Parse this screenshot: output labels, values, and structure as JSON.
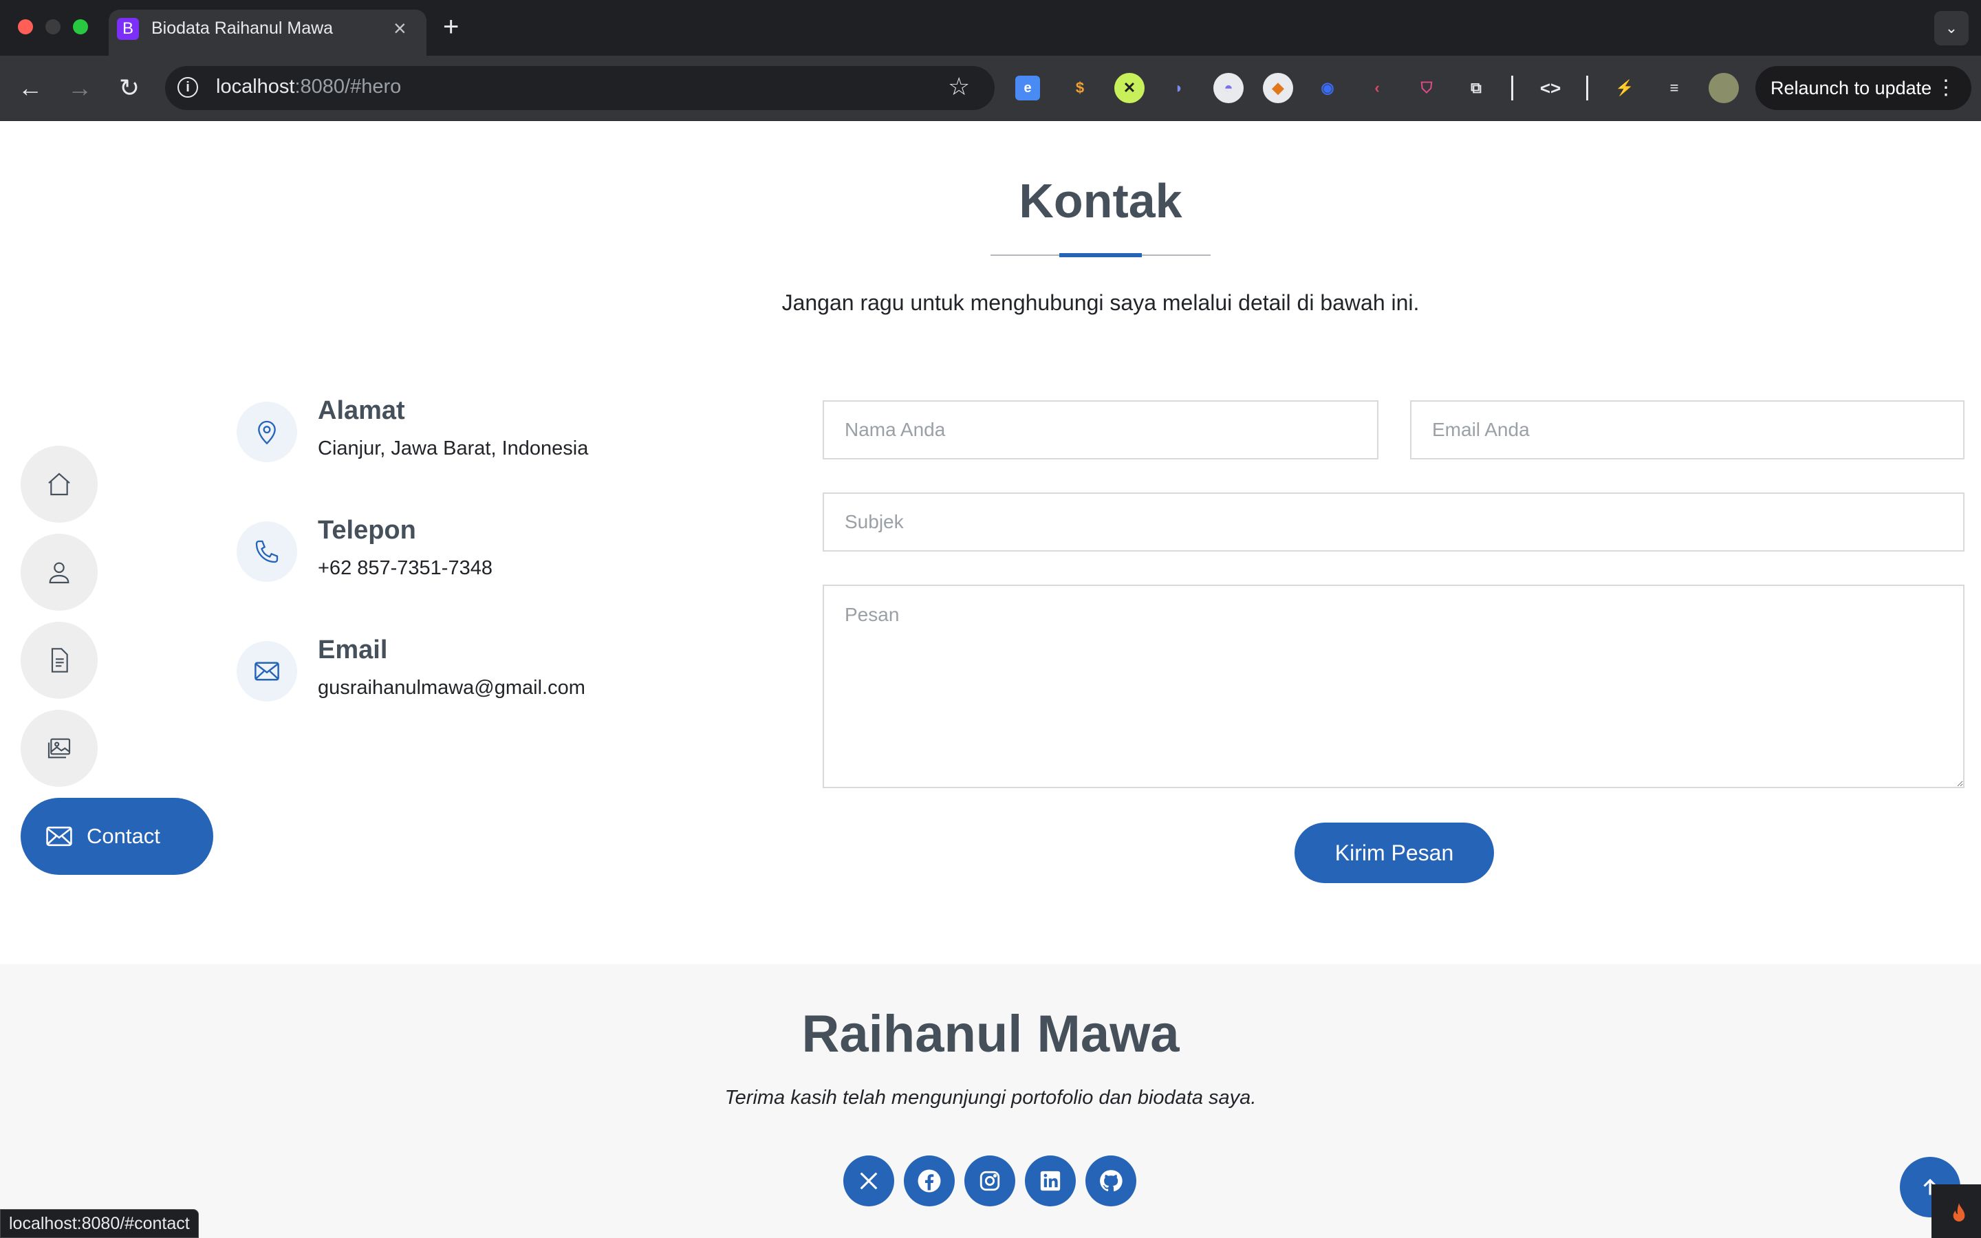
{
  "browser": {
    "tab_title": "Biodata Raihanul Mawa",
    "tab_favicon_letter": "B",
    "url_host": "localhost",
    "url_rest": ":8080/#hero",
    "relaunch_label": "Relaunch to update",
    "status_url": "localhost:8080/#contact"
  },
  "contact": {
    "title": "Kontak",
    "subtitle": "Jangan ragu untuk menghubungi saya melalui detail di bawah ini.",
    "address": {
      "label": "Alamat",
      "value": "Cianjur, Jawa Barat, Indonesia"
    },
    "phone": {
      "label": "Telepon",
      "value": "+62 857-7351-7348"
    },
    "email": {
      "label": "Email",
      "value": "gusraihanulmawa@gmail.com"
    }
  },
  "form": {
    "name_placeholder": "Nama Anda",
    "email_placeholder": "Email Anda",
    "subject_placeholder": "Subjek",
    "message_placeholder": "Pesan",
    "submit_label": "Kirim Pesan"
  },
  "sidenav": {
    "active_label": "Contact"
  },
  "footer": {
    "name": "Raihanul Mawa",
    "tagline": "Terima kasih telah mengunjungi portofolio dan biodata saya."
  },
  "colors": {
    "accent": "#2664b8",
    "heading": "#45505b"
  }
}
